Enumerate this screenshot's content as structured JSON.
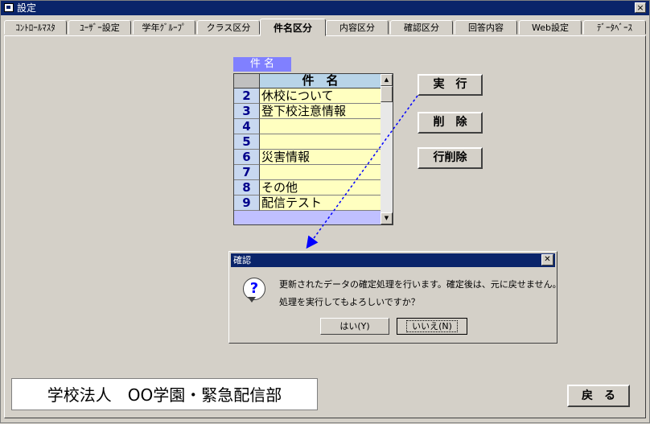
{
  "window": {
    "title": "設定",
    "close_glyph": "×"
  },
  "tabs": [
    {
      "label": "ｺﾝﾄﾛｰﾙﾏｽﾀ"
    },
    {
      "label": "ﾕｰｻﾞｰ設定"
    },
    {
      "label": "学年ｸﾞﾙｰﾌﾟ"
    },
    {
      "label": "クラス区分"
    },
    {
      "label": "件名区分"
    },
    {
      "label": "内容区分"
    },
    {
      "label": "確認区分"
    },
    {
      "label": "回答内容"
    },
    {
      "label": "Web設定"
    },
    {
      "label": "ﾃﾞｰﾀﾍﾞｰｽ"
    }
  ],
  "active_tab": "件名区分",
  "subject_panel": {
    "label": "件 名",
    "grid_header": "件　名",
    "rows": [
      {
        "num": "2",
        "text": "休校について"
      },
      {
        "num": "3",
        "text": "登下校注意情報"
      },
      {
        "num": "4",
        "text": ""
      },
      {
        "num": "5",
        "text": ""
      },
      {
        "num": "6",
        "text": "災害情報"
      },
      {
        "num": "7",
        "text": ""
      },
      {
        "num": "8",
        "text": "その他"
      },
      {
        "num": "9",
        "text": "配信テスト"
      }
    ]
  },
  "actions": {
    "execute_label": "実　行",
    "delete_label": "削　除",
    "delete_row_label": "行削除"
  },
  "dialog": {
    "title": "確認",
    "icon": "question-icon",
    "message_line1": "更新されたデータの確定処理を行います。確定後は、元に戻せません。",
    "message_line2": "処理を実行してもよろしいですか？",
    "yes_label": "はい(Y)",
    "no_label": "いいえ(N)"
  },
  "footer": {
    "organization": "学校法人　OO学園・緊急配信部",
    "back_label": "戻　る"
  },
  "colors": {
    "titlebar": "#0a246a",
    "grid_cell": "#ffffc0",
    "label_bg": "#8080ff",
    "row_number": "#00008b",
    "arrow": "#0000ff"
  }
}
